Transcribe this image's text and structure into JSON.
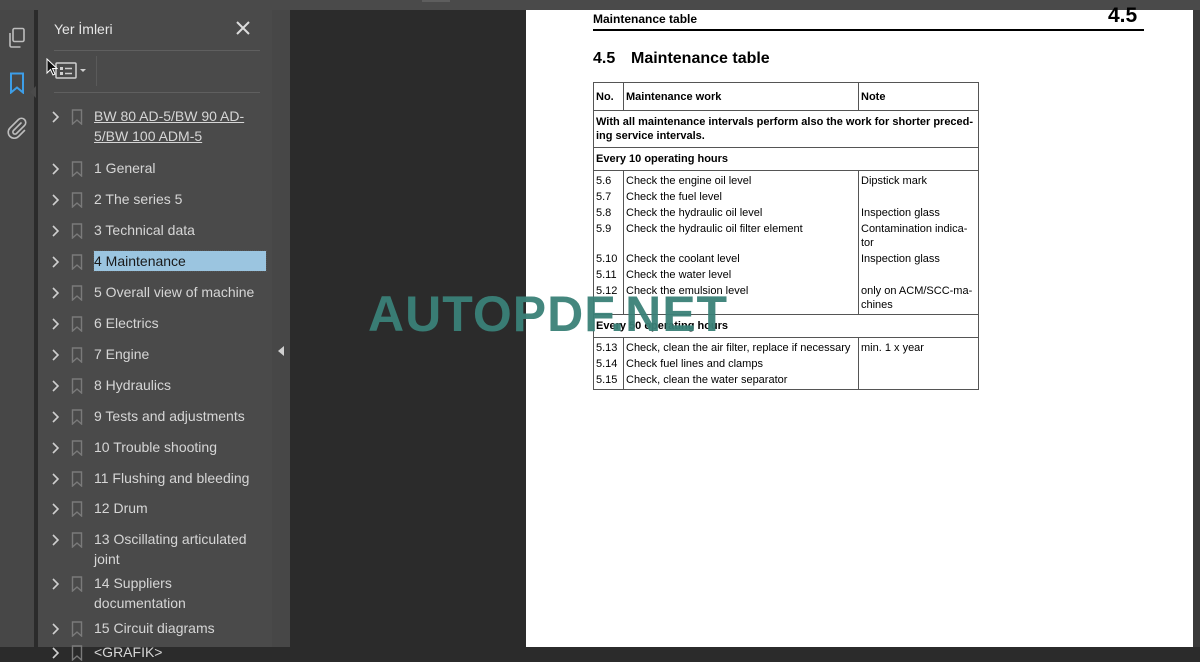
{
  "panel": {
    "title": "Yer İmleri",
    "close_icon": "close-icon",
    "options_icon": "bookmark-options-icon"
  },
  "rail": {
    "icons": [
      "pages-thumbnail-icon",
      "bookmark-icon",
      "attachment-icon"
    ],
    "active": "bookmark-icon",
    "accent": "#3d9ee8"
  },
  "bookmarks": [
    {
      "label": "BW 80 AD-5/BW 90 AD-5/BW 100 ADM-5",
      "link": true
    },
    {
      "label": "1 General"
    },
    {
      "label": "2 The series 5"
    },
    {
      "label": "3 Technical data"
    },
    {
      "label": "4 Maintenance",
      "selected": true
    },
    {
      "label": "5 Overall view of machine"
    },
    {
      "label": "6 Electrics"
    },
    {
      "label": "7 Engine"
    },
    {
      "label": "8 Hydraulics"
    },
    {
      "label": "9 Tests and adjustments"
    },
    {
      "label": "10 Trouble shooting"
    },
    {
      "label": "11 Flushing and bleeding"
    },
    {
      "label": "12 Drum"
    },
    {
      "label": "13 Oscillating articulated joint"
    },
    {
      "label": "14 Suppliers documentation"
    },
    {
      "label": "15 Circuit diagrams"
    },
    {
      "label": "<GRAFIK>"
    }
  ],
  "document": {
    "running_header": "Maintenance table",
    "running_number": "4.5",
    "section_number": "4.5",
    "section_title": "Maintenance table",
    "table": {
      "headers": [
        "No.",
        "Maintenance work",
        "Note"
      ],
      "intro": "With all maintenance intervals perform also the work for shorter preced-ing service intervals.",
      "groups": [
        {
          "title": "Every 10 operating hours",
          "rows": [
            {
              "no": "5.6",
              "work": "Check the engine oil level",
              "note": "Dipstick mark"
            },
            {
              "no": "5.7",
              "work": "Check the fuel level",
              "note": ""
            },
            {
              "no": "5.8",
              "work": "Check the hydraulic oil level",
              "note": "Inspection glass"
            },
            {
              "no": "5.9",
              "work": "Check the hydraulic oil filter element",
              "note": "Contamination indica-tor"
            },
            {
              "no": "5.10",
              "work": "Check the coolant level",
              "note": "Inspection glass"
            },
            {
              "no": "5.11",
              "work": "Check the water level",
              "note": ""
            },
            {
              "no": "5.12",
              "work": "Check the emulsion level",
              "note": "only on ACM/SCC-ma-chines"
            }
          ]
        },
        {
          "title": "Every 50 operating hours",
          "rows": [
            {
              "no": "5.13",
              "work": "Check, clean the air filter, replace if necessary",
              "note": "min. 1 x year"
            },
            {
              "no": "5.14",
              "work": "Check fuel lines and clamps",
              "note": ""
            },
            {
              "no": "5.15",
              "work": "Check, clean the water separator",
              "note": ""
            }
          ]
        }
      ]
    }
  },
  "watermark": "AUTOPDF.NET"
}
